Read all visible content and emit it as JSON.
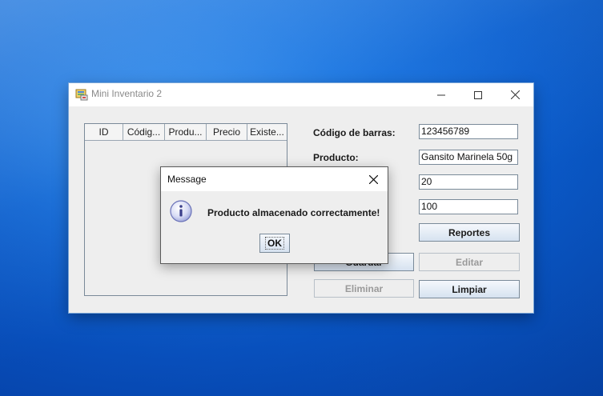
{
  "window": {
    "title": "Mini Inventario 2",
    "controls": {
      "minimize": "minimize",
      "maximize": "maximize",
      "close": "close"
    }
  },
  "table": {
    "columns": [
      "ID",
      "Códig...",
      "Produ...",
      "Precio",
      "Existe..."
    ],
    "rows": []
  },
  "form": {
    "barcode_label": "Código de barras:",
    "barcode_value": "123456789",
    "product_label": "Producto:",
    "product_value": "Gansito Marinela 50g",
    "price_value": "20",
    "stock_value": "100"
  },
  "buttons": {
    "reportes": "Reportes",
    "guardar": "Guardar",
    "editar": "Editar",
    "eliminar": "Eliminar",
    "limpiar": "Limpiar"
  },
  "dialog": {
    "title": "Message",
    "message": "Producto almacenado correctamente!",
    "ok_label": "OK",
    "icon": "info-icon"
  },
  "colors": {
    "desktop": "#1a7be8",
    "window_bg": "#eeeeee",
    "button_gradient_top": "#f5f8fc",
    "button_gradient_bottom": "#d6e2f0",
    "disabled_text": "#9a9a9a"
  }
}
